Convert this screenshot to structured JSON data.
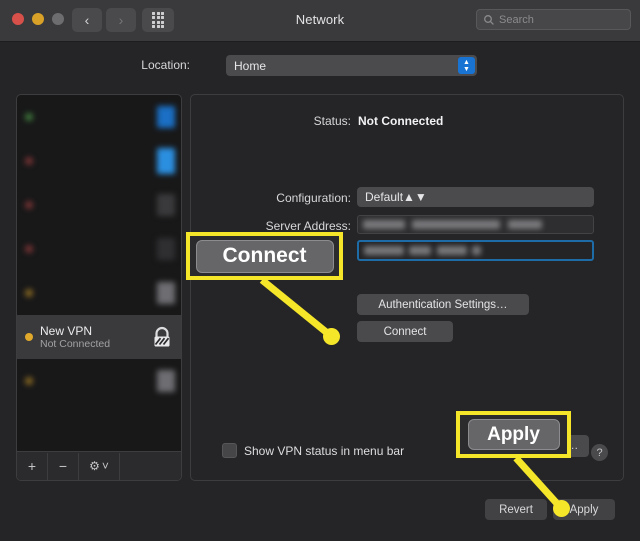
{
  "window": {
    "title": "Network",
    "traffic_lights": [
      "close",
      "minimize",
      "zoom"
    ],
    "nav_back_icon": "chevron-left-icon",
    "nav_forward_icon": "chevron-right-icon",
    "grid_icon": "show-all-preferences-icon"
  },
  "search": {
    "placeholder": "Search",
    "icon": "search-icon",
    "value": ""
  },
  "location": {
    "label": "Location:",
    "value": "Home",
    "stepper_icon": "chevron-up-down-icon"
  },
  "sidebar": {
    "services": [
      {
        "name": "",
        "state": "",
        "blurred": true,
        "dot_color": "#3f7a3a",
        "chip_color": "#1b6fc4"
      },
      {
        "name": "",
        "state": "",
        "blurred": true,
        "dot_color": "#7a3434",
        "chip_color": "#2b8fe0"
      },
      {
        "name": "",
        "state": "",
        "blurred": true,
        "dot_color": "#7a3434",
        "chip_color": "#3a3a3c"
      },
      {
        "name": "",
        "state": "",
        "blurred": true,
        "dot_color": "#7a3434",
        "chip_color": "#2f2f31"
      },
      {
        "name": "",
        "state": "",
        "blurred": true,
        "dot_color": "#8a6a22",
        "chip_color": "#6e6e72"
      },
      {
        "name": "New VPN",
        "state": "Not Connected",
        "blurred": false,
        "selected": true,
        "dot_color": "#e0a92b",
        "glyph": "vpn-lock-icon"
      },
      {
        "name": "",
        "state": "",
        "blurred": true,
        "dot_color": "#8a6a22",
        "chip_color": "#6e6e72"
      }
    ],
    "footer": {
      "add_label": "+",
      "remove_label": "−",
      "gear_label": "⚙",
      "gear_chevron": "˅"
    }
  },
  "detail": {
    "status_label": "Status:",
    "status_value": "Not Connected",
    "configuration_label": "Configuration:",
    "configuration_value": "Default",
    "server_address_label": "Server Address:",
    "server_address_value": "",
    "account_name_value": "",
    "authentication_settings_label": "Authentication Settings…",
    "connect_label": "Connect",
    "show_status_checkbox_label": "Show VPN status in menu bar",
    "show_status_checked": false,
    "advanced_label": "Advanced…",
    "help_label": "?"
  },
  "bottom_bar": {
    "revert_label": "Revert",
    "apply_label": "Apply"
  },
  "annotations": {
    "highlight_color": "#f5e62a",
    "callouts": [
      {
        "label": "Connect",
        "target": "connect-button"
      },
      {
        "label": "Apply",
        "target": "apply-button"
      }
    ]
  }
}
